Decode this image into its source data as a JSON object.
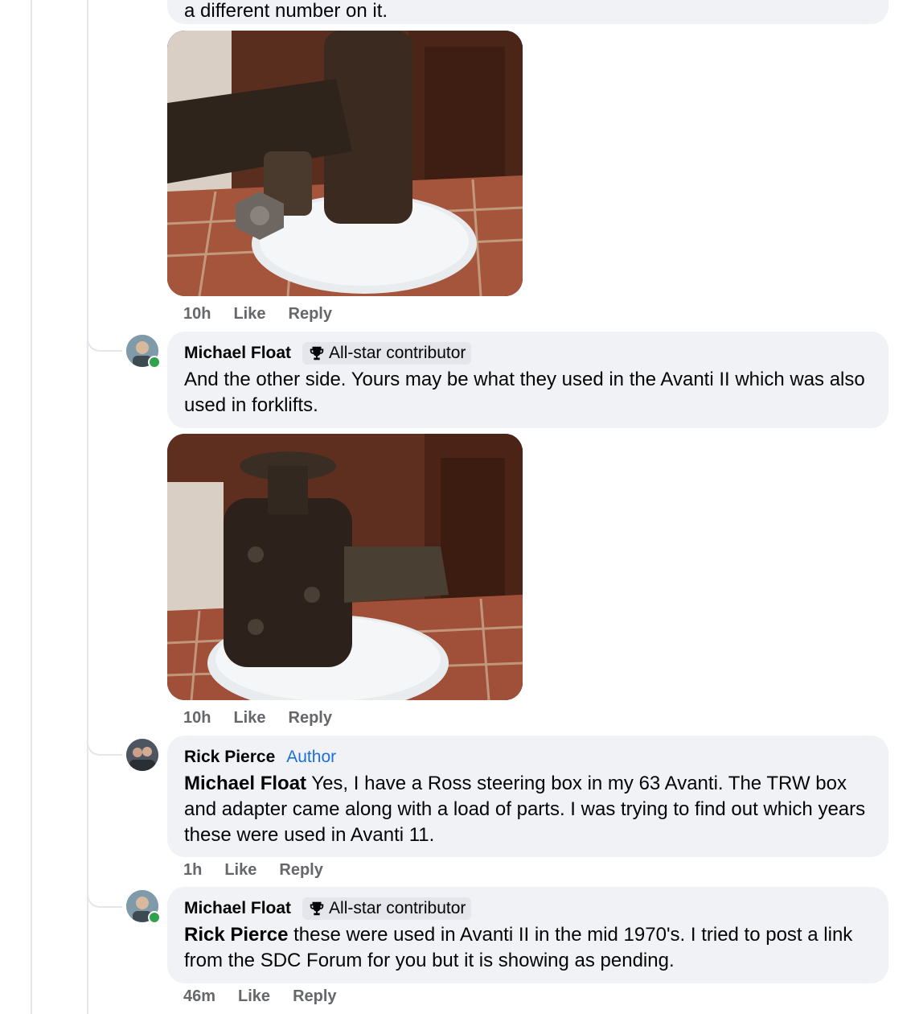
{
  "top_comment": {
    "text_partial": "a different number on it."
  },
  "comments": [
    {
      "time": "10h",
      "like": "Like",
      "reply": "Reply"
    },
    {
      "author": "Michael Float",
      "badge": "All-star contributor",
      "text": "And the other side. Yours may be what they used in the Avanti II which was also used in forklifts.",
      "time": "10h",
      "like": "Like",
      "reply": "Reply"
    },
    {
      "author": "Rick Pierce",
      "author_tag": "Author",
      "mention": "Michael Float",
      "text": " Yes, I have a Ross steering box in my 63 Avanti. The TRW box and adapter came along with a load of parts. I was trying to find out which years these were used in Avanti 11.",
      "time": "1h",
      "like": "Like",
      "reply": "Reply"
    },
    {
      "author": "Michael Float",
      "badge": "All-star contributor",
      "mention": "Rick Pierce",
      "text": " these were used in Avanti II in the mid 1970's. I tried to post a link from the SDC Forum for you but it is showing as pending.",
      "time": "46m",
      "like": "Like",
      "reply": "Reply"
    }
  ],
  "icons": {
    "badge": "trophy-icon",
    "presence": "online-dot"
  },
  "colors": {
    "bubble": "#f0f2f5",
    "meta": "#65676b",
    "author_tag": "#1c6fd8",
    "online": "#31a24c"
  }
}
